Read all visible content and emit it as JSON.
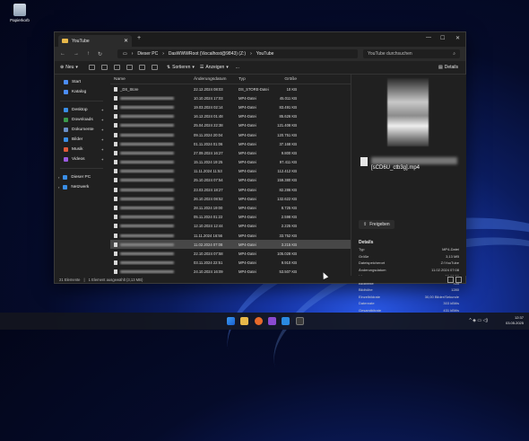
{
  "desktop": {
    "recycle_bin_label": "Papierkorb"
  },
  "window": {
    "tab_title": "YouTube",
    "breadcrumb": [
      "Dieser PC",
      "DasWWWRoot (\\\\localhost@9843) (Z:)",
      "YouTube"
    ],
    "search_placeholder": "YouTube durchsuchen",
    "toolbar": {
      "new_label": "Neu",
      "sort_label": "Sortieren",
      "view_label": "Anzeigen",
      "more_label": "...",
      "details_label": "Details"
    },
    "sidebar": {
      "items": [
        {
          "label": "Start",
          "icon": "home-icon",
          "color": "#4c8df6"
        },
        {
          "label": "Katalog",
          "icon": "gallery-icon",
          "color": "#4c8df6"
        }
      ],
      "pinned": [
        {
          "label": "Desktop",
          "icon": "desktop-icon",
          "color": "#3a8ee6"
        },
        {
          "label": "Downloads",
          "icon": "download-icon",
          "color": "#3a9a4a"
        },
        {
          "label": "Dokumente",
          "icon": "documents-icon",
          "color": "#6a8fc7"
        },
        {
          "label": "Bilder",
          "icon": "pictures-icon",
          "color": "#3a8ee6"
        },
        {
          "label": "Musik",
          "icon": "music-icon",
          "color": "#e05a3a"
        },
        {
          "label": "Videos",
          "icon": "videos-icon",
          "color": "#9a5ae0"
        }
      ],
      "drives": [
        {
          "label": "Dieser PC",
          "icon": "pc-icon",
          "color": "#3a8ee6"
        },
        {
          "label": "Netzwerk",
          "icon": "network-icon",
          "color": "#3a8ee6"
        }
      ]
    },
    "columns": {
      "name": "Name",
      "date": "Änderungsdatum",
      "type": "Typ",
      "size": "Größe"
    },
    "files": [
      {
        "name": "_DS_Store",
        "date": "22.12.2024 08:03",
        "type": "DS_STORE-Datei",
        "size": "10 KB"
      },
      {
        "name": "",
        "date": "10.10.2024 17:03",
        "type": "MP4-Datei",
        "size": "45.011 KB"
      },
      {
        "name": "",
        "date": "19.03.2024 02:14",
        "type": "MP4-Datei",
        "size": "83.491 KB"
      },
      {
        "name": "",
        "date": "16.12.2024 01:48",
        "type": "MP4-Datei",
        "size": "85.626 KB"
      },
      {
        "name": "",
        "date": "25.04.2024 22:38",
        "type": "MP4-Datei",
        "size": "121.408 KB"
      },
      {
        "name": "",
        "date": "09.11.2024 20:04",
        "type": "MP4-Datei",
        "size": "120.751 KB"
      },
      {
        "name": "",
        "date": "01.11.2024 01:06",
        "type": "MP4-Datei",
        "size": "37.168 KB"
      },
      {
        "name": "",
        "date": "27.09.2024 16:27",
        "type": "MP4-Datei",
        "size": "9.800 KB"
      },
      {
        "name": "",
        "date": "15.11.2024 19:25",
        "type": "MP4-Datei",
        "size": "97.411 KB"
      },
      {
        "name": "",
        "date": "11.11.2024 11:53",
        "type": "MP4-Datei",
        "size": "112.412 KB"
      },
      {
        "name": "",
        "date": "25.10.2024 07:54",
        "type": "MP4-Datei",
        "size": "159.380 KB"
      },
      {
        "name": "",
        "date": "23.03.2024 18:27",
        "type": "MP4-Datei",
        "size": "82.286 KB"
      },
      {
        "name": "",
        "date": "26.10.2024 08:52",
        "type": "MP4-Datei",
        "size": "132.622 KB"
      },
      {
        "name": "",
        "date": "28.11.2024 19:00",
        "type": "MP4-Datei",
        "size": "8.725 KB"
      },
      {
        "name": "",
        "date": "05.11.2024 01:22",
        "type": "MP4-Datei",
        "size": "2.598 KB"
      },
      {
        "name": "",
        "date": "12.10.2024 12:44",
        "type": "MP4-Datei",
        "size": "2.225 KB"
      },
      {
        "name": "",
        "date": "11.11.2024 16:56",
        "type": "MP4-Datei",
        "size": "33.752 KB"
      },
      {
        "name": "",
        "date": "11.02.2024 07:08",
        "type": "MP4-Datei",
        "size": "3.215 KB",
        "selected": true
      },
      {
        "name": "",
        "date": "22.10.2024 07:58",
        "type": "MP4-Datei",
        "size": "105.028 KB"
      },
      {
        "name": "",
        "date": "03.11.2024 22:51",
        "type": "MP4-Datei",
        "size": "9.910 KB"
      },
      {
        "name": "",
        "date": "24.10.2024 16:09",
        "type": "MP4-Datei",
        "size": "53.507 KB"
      }
    ],
    "preview": {
      "file_name": "[sCD6U_ctb3g].mp4",
      "share_label": "Freigeben",
      "details_title": "Details",
      "details": [
        {
          "k": "Typ",
          "v": "MP4-Datei"
        },
        {
          "k": "Größe",
          "v": "3,13 MB"
        },
        {
          "k": "Dateispeicherort",
          "v": "Z:\\YouTube"
        },
        {
          "k": "Änderungsdatum",
          "v": "11.02.2024 07:08"
        },
        {
          "k": "Länge",
          "v": "00:00:59"
        },
        {
          "k": "Bildbreite",
          "v": "720"
        },
        {
          "k": "Bildhöhe",
          "v": "1280"
        },
        {
          "k": "Einzelbildrate",
          "v": "30,00 Bilder/Sekunde"
        },
        {
          "k": "Datenrate",
          "v": "303 kBit/s"
        },
        {
          "k": "Gesamtbitrate",
          "v": "431 kBit/s"
        }
      ]
    },
    "status": {
      "count": "21 Elemente",
      "selection": "1 Element ausgewählt (3,13 MB)"
    }
  },
  "taskbar": {
    "time": "12:37",
    "date": "03.05.2025"
  }
}
